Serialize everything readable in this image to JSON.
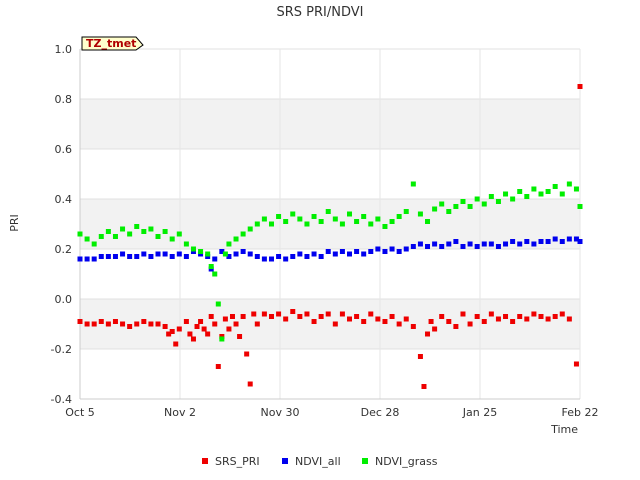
{
  "chart_data": {
    "type": "scatter",
    "title": "SRS PRI/NDVI",
    "badge": "TZ_tmet",
    "xlabel": "Time",
    "ylabel": "PRI",
    "ylim": [
      -0.4,
      1.0
    ],
    "y_ticks": [
      "-0.4",
      "-0.2",
      "0.0",
      "0.2",
      "0.4",
      "0.6",
      "0.8",
      "1.0"
    ],
    "x_ticks": [
      "Oct 5",
      "Nov 2",
      "Nov 30",
      "Dec 28",
      "Jan 25",
      "Feb 22"
    ],
    "legend_position": "bottom",
    "series": [
      {
        "name": "SRS_PRI",
        "color": "#ee0000",
        "points": [
          [
            0,
            -0.09
          ],
          [
            2,
            -0.1
          ],
          [
            4,
            -0.1
          ],
          [
            6,
            -0.09
          ],
          [
            8,
            -0.1
          ],
          [
            10,
            -0.09
          ],
          [
            12,
            -0.1
          ],
          [
            14,
            -0.11
          ],
          [
            16,
            -0.1
          ],
          [
            18,
            -0.09
          ],
          [
            20,
            -0.1
          ],
          [
            22,
            -0.1
          ],
          [
            24,
            -0.11
          ],
          [
            25,
            -0.14
          ],
          [
            26,
            -0.13
          ],
          [
            27,
            -0.18
          ],
          [
            28,
            -0.12
          ],
          [
            30,
            -0.09
          ],
          [
            31,
            -0.14
          ],
          [
            32,
            -0.16
          ],
          [
            33,
            -0.11
          ],
          [
            34,
            -0.09
          ],
          [
            35,
            -0.12
          ],
          [
            36,
            -0.14
          ],
          [
            37,
            -0.07
          ],
          [
            38,
            -0.1
          ],
          [
            39,
            -0.27
          ],
          [
            40,
            -0.15
          ],
          [
            41,
            -0.08
          ],
          [
            42,
            -0.12
          ],
          [
            43,
            -0.07
          ],
          [
            44,
            -0.1
          ],
          [
            45,
            -0.15
          ],
          [
            46,
            -0.07
          ],
          [
            47,
            -0.22
          ],
          [
            48,
            -0.34
          ],
          [
            49,
            -0.06
          ],
          [
            50,
            -0.1
          ],
          [
            52,
            -0.06
          ],
          [
            54,
            -0.07
          ],
          [
            56,
            -0.06
          ],
          [
            58,
            -0.08
          ],
          [
            60,
            -0.05
          ],
          [
            62,
            -0.07
          ],
          [
            64,
            -0.06
          ],
          [
            66,
            -0.09
          ],
          [
            68,
            -0.07
          ],
          [
            70,
            -0.06
          ],
          [
            72,
            -0.1
          ],
          [
            74,
            -0.06
          ],
          [
            76,
            -0.08
          ],
          [
            78,
            -0.07
          ],
          [
            80,
            -0.09
          ],
          [
            82,
            -0.06
          ],
          [
            84,
            -0.08
          ],
          [
            86,
            -0.09
          ],
          [
            88,
            -0.07
          ],
          [
            90,
            -0.1
          ],
          [
            92,
            -0.08
          ],
          [
            94,
            -0.11
          ],
          [
            96,
            -0.23
          ],
          [
            97,
            -0.35
          ],
          [
            98,
            -0.14
          ],
          [
            99,
            -0.09
          ],
          [
            100,
            -0.12
          ],
          [
            102,
            -0.07
          ],
          [
            104,
            -0.09
          ],
          [
            106,
            -0.11
          ],
          [
            108,
            -0.06
          ],
          [
            110,
            -0.1
          ],
          [
            112,
            -0.07
          ],
          [
            114,
            -0.09
          ],
          [
            116,
            -0.06
          ],
          [
            118,
            -0.08
          ],
          [
            120,
            -0.07
          ],
          [
            122,
            -0.09
          ],
          [
            124,
            -0.07
          ],
          [
            126,
            -0.08
          ],
          [
            128,
            -0.06
          ],
          [
            130,
            -0.07
          ],
          [
            132,
            -0.08
          ],
          [
            134,
            -0.07
          ],
          [
            136,
            -0.06
          ],
          [
            138,
            -0.08
          ],
          [
            140,
            -0.26
          ],
          [
            141,
            0.85
          ]
        ]
      },
      {
        "name": "NDVI_all",
        "color": "#0000ee",
        "points": [
          [
            0,
            0.16
          ],
          [
            2,
            0.16
          ],
          [
            4,
            0.16
          ],
          [
            6,
            0.17
          ],
          [
            8,
            0.17
          ],
          [
            10,
            0.17
          ],
          [
            12,
            0.18
          ],
          [
            14,
            0.17
          ],
          [
            16,
            0.17
          ],
          [
            18,
            0.18
          ],
          [
            20,
            0.17
          ],
          [
            22,
            0.18
          ],
          [
            24,
            0.18
          ],
          [
            26,
            0.17
          ],
          [
            28,
            0.18
          ],
          [
            30,
            0.17
          ],
          [
            32,
            0.19
          ],
          [
            34,
            0.18
          ],
          [
            36,
            0.17
          ],
          [
            37,
            0.12
          ],
          [
            38,
            0.16
          ],
          [
            40,
            0.19
          ],
          [
            42,
            0.17
          ],
          [
            44,
            0.18
          ],
          [
            46,
            0.19
          ],
          [
            48,
            0.18
          ],
          [
            50,
            0.17
          ],
          [
            52,
            0.16
          ],
          [
            54,
            0.16
          ],
          [
            56,
            0.17
          ],
          [
            58,
            0.16
          ],
          [
            60,
            0.17
          ],
          [
            62,
            0.18
          ],
          [
            64,
            0.17
          ],
          [
            66,
            0.18
          ],
          [
            68,
            0.17
          ],
          [
            70,
            0.19
          ],
          [
            72,
            0.18
          ],
          [
            74,
            0.19
          ],
          [
            76,
            0.18
          ],
          [
            78,
            0.19
          ],
          [
            80,
            0.18
          ],
          [
            82,
            0.19
          ],
          [
            84,
            0.2
          ],
          [
            86,
            0.19
          ],
          [
            88,
            0.2
          ],
          [
            90,
            0.19
          ],
          [
            92,
            0.2
          ],
          [
            94,
            0.21
          ],
          [
            96,
            0.22
          ],
          [
            98,
            0.21
          ],
          [
            100,
            0.22
          ],
          [
            102,
            0.21
          ],
          [
            104,
            0.22
          ],
          [
            106,
            0.23
          ],
          [
            108,
            0.21
          ],
          [
            110,
            0.22
          ],
          [
            112,
            0.21
          ],
          [
            114,
            0.22
          ],
          [
            116,
            0.22
          ],
          [
            118,
            0.21
          ],
          [
            120,
            0.22
          ],
          [
            122,
            0.23
          ],
          [
            124,
            0.22
          ],
          [
            126,
            0.23
          ],
          [
            128,
            0.22
          ],
          [
            130,
            0.23
          ],
          [
            132,
            0.23
          ],
          [
            134,
            0.24
          ],
          [
            136,
            0.23
          ],
          [
            138,
            0.24
          ],
          [
            140,
            0.24
          ],
          [
            141,
            0.23
          ]
        ]
      },
      {
        "name": "NDVI_grass",
        "color": "#00ee00",
        "points": [
          [
            0,
            0.26
          ],
          [
            2,
            0.24
          ],
          [
            4,
            0.22
          ],
          [
            6,
            0.25
          ],
          [
            8,
            0.27
          ],
          [
            10,
            0.25
          ],
          [
            12,
            0.28
          ],
          [
            14,
            0.26
          ],
          [
            16,
            0.29
          ],
          [
            18,
            0.27
          ],
          [
            20,
            0.28
          ],
          [
            22,
            0.25
          ],
          [
            24,
            0.27
          ],
          [
            26,
            0.24
          ],
          [
            28,
            0.26
          ],
          [
            30,
            0.22
          ],
          [
            32,
            0.2
          ],
          [
            34,
            0.19
          ],
          [
            36,
            0.18
          ],
          [
            37,
            0.13
          ],
          [
            38,
            0.1
          ],
          [
            39,
            -0.02
          ],
          [
            40,
            -0.16
          ],
          [
            41,
            0.18
          ],
          [
            42,
            0.22
          ],
          [
            44,
            0.24
          ],
          [
            46,
            0.26
          ],
          [
            48,
            0.28
          ],
          [
            50,
            0.3
          ],
          [
            52,
            0.32
          ],
          [
            54,
            0.3
          ],
          [
            56,
            0.33
          ],
          [
            58,
            0.31
          ],
          [
            60,
            0.34
          ],
          [
            62,
            0.32
          ],
          [
            64,
            0.3
          ],
          [
            66,
            0.33
          ],
          [
            68,
            0.31
          ],
          [
            70,
            0.35
          ],
          [
            72,
            0.32
          ],
          [
            74,
            0.3
          ],
          [
            76,
            0.34
          ],
          [
            78,
            0.31
          ],
          [
            80,
            0.33
          ],
          [
            82,
            0.3
          ],
          [
            84,
            0.32
          ],
          [
            86,
            0.29
          ],
          [
            88,
            0.31
          ],
          [
            90,
            0.33
          ],
          [
            92,
            0.35
          ],
          [
            94,
            0.46
          ],
          [
            96,
            0.34
          ],
          [
            98,
            0.31
          ],
          [
            100,
            0.36
          ],
          [
            102,
            0.38
          ],
          [
            104,
            0.35
          ],
          [
            106,
            0.37
          ],
          [
            108,
            0.39
          ],
          [
            110,
            0.37
          ],
          [
            112,
            0.4
          ],
          [
            114,
            0.38
          ],
          [
            116,
            0.41
          ],
          [
            118,
            0.39
          ],
          [
            120,
            0.42
          ],
          [
            122,
            0.4
          ],
          [
            124,
            0.43
          ],
          [
            126,
            0.41
          ],
          [
            128,
            0.44
          ],
          [
            130,
            0.42
          ],
          [
            132,
            0.43
          ],
          [
            134,
            0.45
          ],
          [
            136,
            0.42
          ],
          [
            138,
            0.46
          ],
          [
            140,
            0.44
          ],
          [
            141,
            0.37
          ]
        ]
      }
    ]
  }
}
